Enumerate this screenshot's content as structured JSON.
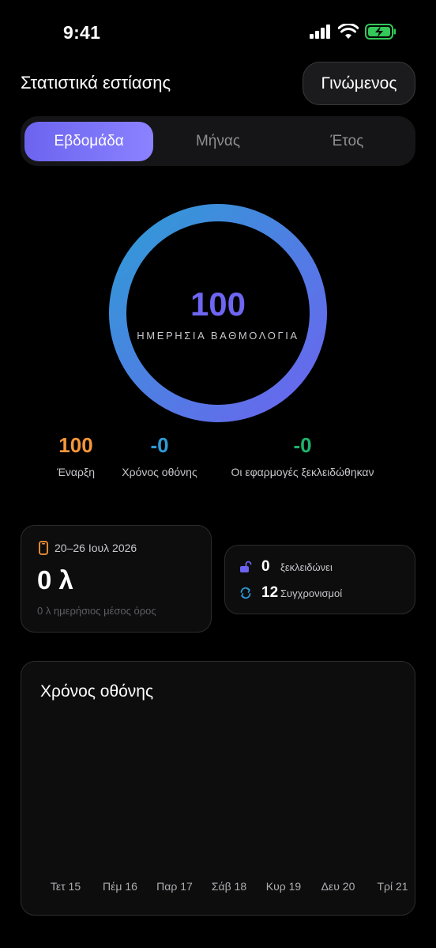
{
  "status_bar": {
    "time": "9:41"
  },
  "header": {
    "title": "Στατιστικά εστίασης",
    "pro_label": "Γινώμενος"
  },
  "tabs": [
    {
      "label": "Εβδομάδα",
      "active": true
    },
    {
      "label": "Μήνας",
      "active": false
    },
    {
      "label": "Έτος",
      "active": false
    }
  ],
  "score": {
    "value": "100",
    "label": "ΗΜΕΡΗΣΙΑ ΒΑΘΜΟΛΟΓΙΑ",
    "progress": 1.0
  },
  "stats": [
    {
      "value": "100",
      "label": "Έναρξη",
      "color": "#f7963a"
    },
    {
      "value": "-0",
      "label": "Χρόνος οθόνης",
      "color": "#2f9bd6"
    },
    {
      "value": "-0",
      "label": "Οι εφαρμογές ξεκλειδώθηκαν",
      "color": "#1fb36a"
    }
  ],
  "week_card": {
    "date_range": "20–26 Ιουλ 2026",
    "total": "0 λ",
    "average": "0 λ ημερήσιος μέσος όρος"
  },
  "mini_card": {
    "unlocks": {
      "value": "0",
      "label": "ξεκλειδώνει"
    },
    "syncs": {
      "value": "12",
      "label": "Συγχρονισμοί"
    }
  },
  "screen_time_card": {
    "title": "Χρόνος οθόνης",
    "days": [
      "Τετ 15",
      "Πέμ 16",
      "Παρ 17",
      "Σάβ 18",
      "Κυρ 19",
      "Δευ 20",
      "Τρί 21"
    ]
  },
  "chart_data": {
    "type": "bar",
    "title": "Χρόνος οθόνης",
    "categories": [
      "Τετ 15",
      "Πέμ 16",
      "Παρ 17",
      "Σάβ 18",
      "Κυρ 19",
      "Δευ 20",
      "Τρί 21"
    ],
    "values": [
      0,
      0,
      0,
      0,
      0,
      0,
      0
    ],
    "xlabel": "",
    "ylabel": "",
    "grid": false
  },
  "colors": {
    "accent": "#6c64ef",
    "ring_start": "#2f9bd6",
    "ring_end": "#6c64ef",
    "background": "#000000"
  }
}
